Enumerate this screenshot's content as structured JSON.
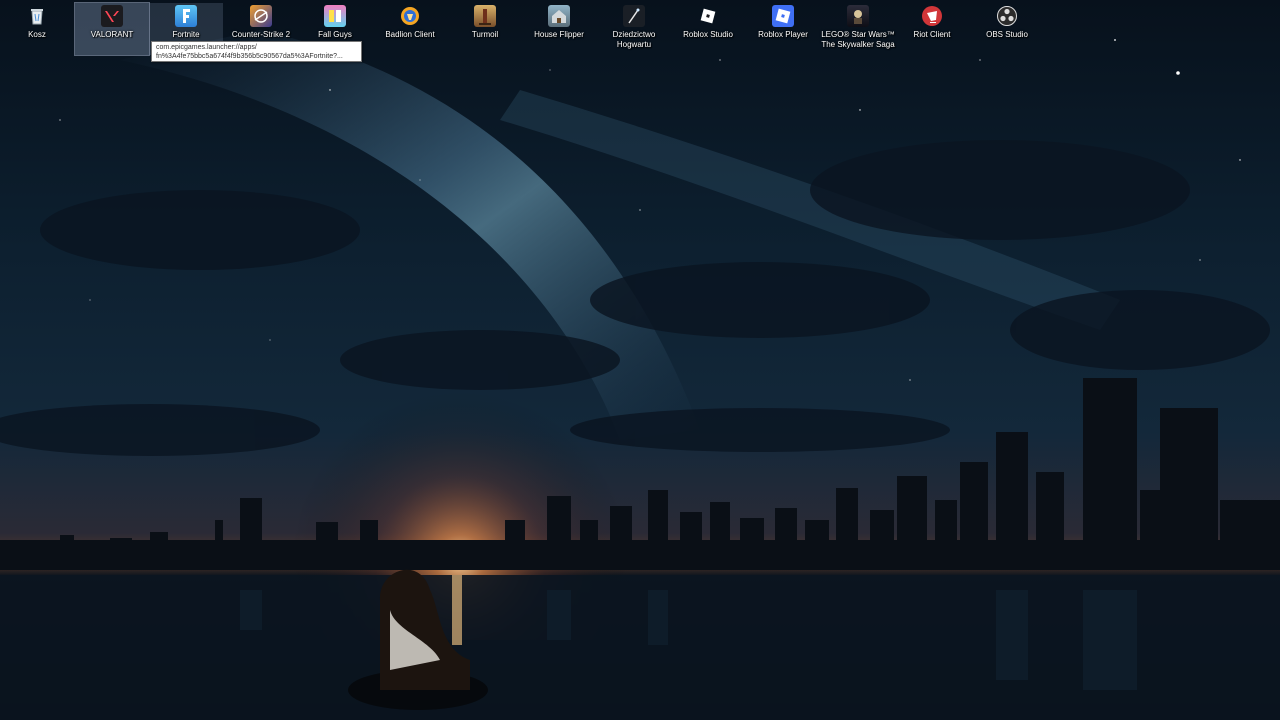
{
  "desktop": {
    "icons": [
      {
        "label": "Kosz",
        "icon": "recycle-bin-icon"
      },
      {
        "label": "VALORANT",
        "icon": "valorant-icon"
      },
      {
        "label": "Fortnite",
        "icon": "fortnite-icon"
      },
      {
        "label": "Counter-Strike 2",
        "icon": "counter-strike-icon"
      },
      {
        "label": "Fall Guys",
        "icon": "fall-guys-icon"
      },
      {
        "label": "Badlion Client",
        "icon": "badlion-icon"
      },
      {
        "label": "Turmoil",
        "icon": "turmoil-icon"
      },
      {
        "label": "House Flipper",
        "icon": "house-flipper-icon"
      },
      {
        "label": "Dziedzictwo Hogwartu",
        "icon": "hogwarts-legacy-icon"
      },
      {
        "label": "Roblox Studio",
        "icon": "roblox-studio-icon"
      },
      {
        "label": "Roblox Player",
        "icon": "roblox-player-icon"
      },
      {
        "label": "LEGO® Star Wars™ The Skywalker Saga",
        "icon": "lego-star-wars-icon"
      },
      {
        "label": "Riot Client",
        "icon": "riot-client-icon"
      },
      {
        "label": "OBS Studio",
        "icon": "obs-studio-icon"
      }
    ],
    "tooltip": {
      "line1": "com.epicgames.launcher://apps/",
      "line2": "fn%3A4fe75bbc5a674f4f9b356b5c90567da5%3AFortnite?..."
    }
  },
  "colors": {
    "icon_selection": "#96aac8",
    "tooltip_bg": "#ffffff",
    "tooltip_border": "#767676"
  }
}
